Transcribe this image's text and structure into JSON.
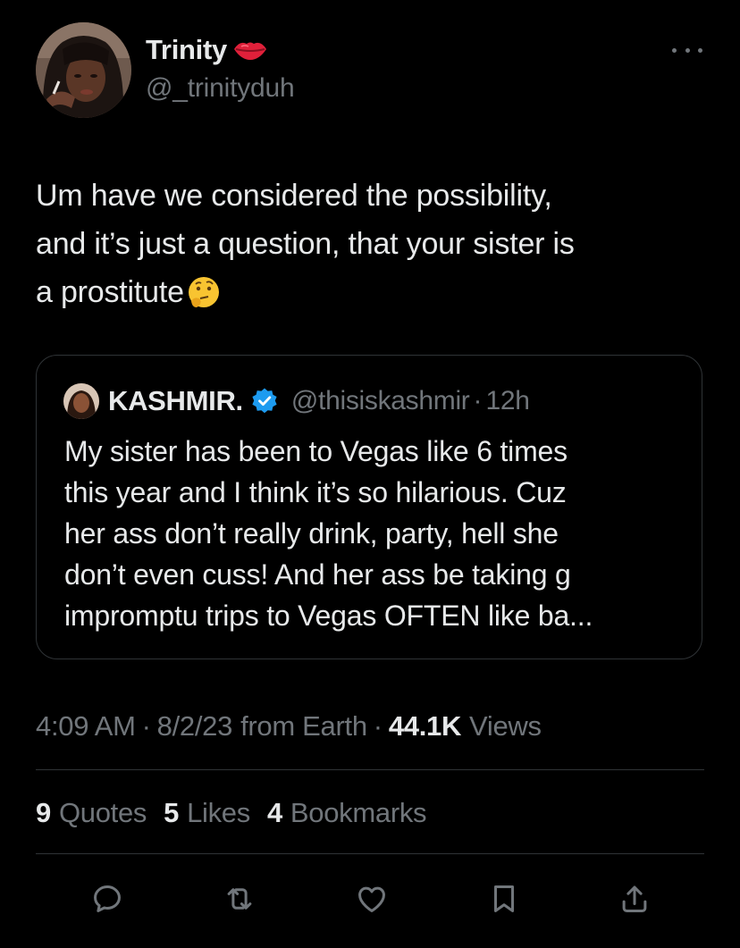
{
  "author": {
    "name": "Trinity",
    "handle": "@_trinityduh",
    "name_emoji": "kiss-mark-icon"
  },
  "tweet": {
    "lines": [
      "Um have we considered the possibility,",
      "and it’s just a question, that your sister is",
      "a prostitute"
    ],
    "trailing_emoji": "thinking-face-icon"
  },
  "quote": {
    "name": "KASHMIR.",
    "verified": true,
    "handle": "@thisiskashmir",
    "separator": "·",
    "time": "12h",
    "lines": [
      "My sister has been to Vegas like 6 times",
      "this year and I think it’s so hilarious. Cuz",
      "her ass don’t really drink, party, hell she",
      "don’t even cuss! And her ass be taking g",
      "impromptu trips to Vegas OFTEN like ba..."
    ]
  },
  "meta": {
    "time": "4:09 AM",
    "separator": "·",
    "date": "8/2/23",
    "source": "from Earth",
    "views_count": "44.1K",
    "views_label": "Views"
  },
  "stats": [
    {
      "count": "9",
      "label": "Quotes"
    },
    {
      "count": "5",
      "label": "Likes"
    },
    {
      "count": "4",
      "label": "Bookmarks"
    }
  ],
  "actions": [
    "reply-icon",
    "retweet-icon",
    "like-icon",
    "bookmark-icon",
    "share-icon"
  ],
  "colors": {
    "background": "#000000",
    "text_primary": "#e7e9ea",
    "text_secondary": "#71767b",
    "border": "#2f3336",
    "verified": "#1d9bf0"
  }
}
